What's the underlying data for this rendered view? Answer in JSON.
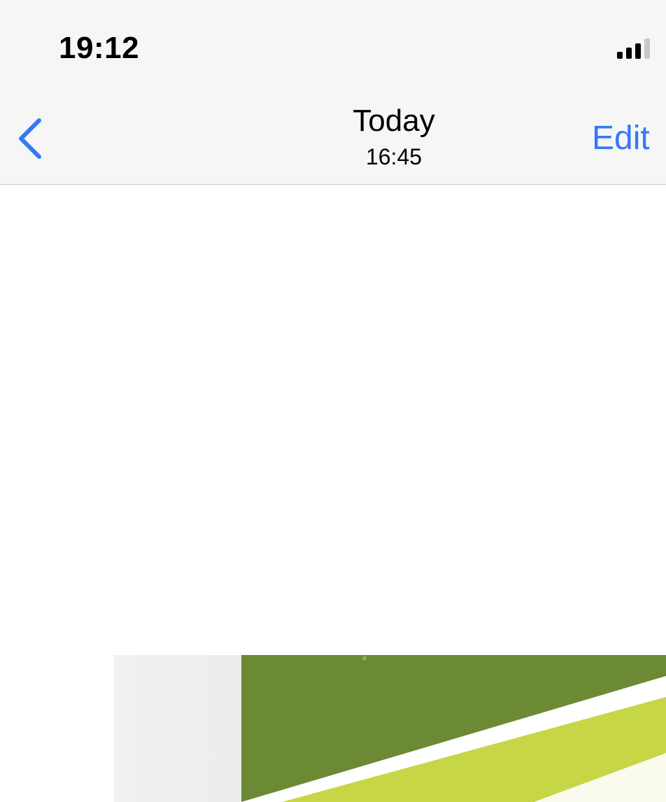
{
  "status_bar": {
    "time": "19:12",
    "signal_icon": "cellular-signal-icon"
  },
  "nav_bar": {
    "back_icon": "chevron-left-icon",
    "title": "Today",
    "subtitle": "16:45",
    "edit_label": "Edit"
  },
  "colors": {
    "accent": "#3478f6",
    "bar_background": "#f6f6f6",
    "photo_dark_green": "#6b8a33",
    "photo_light_green": "#c6d646"
  }
}
